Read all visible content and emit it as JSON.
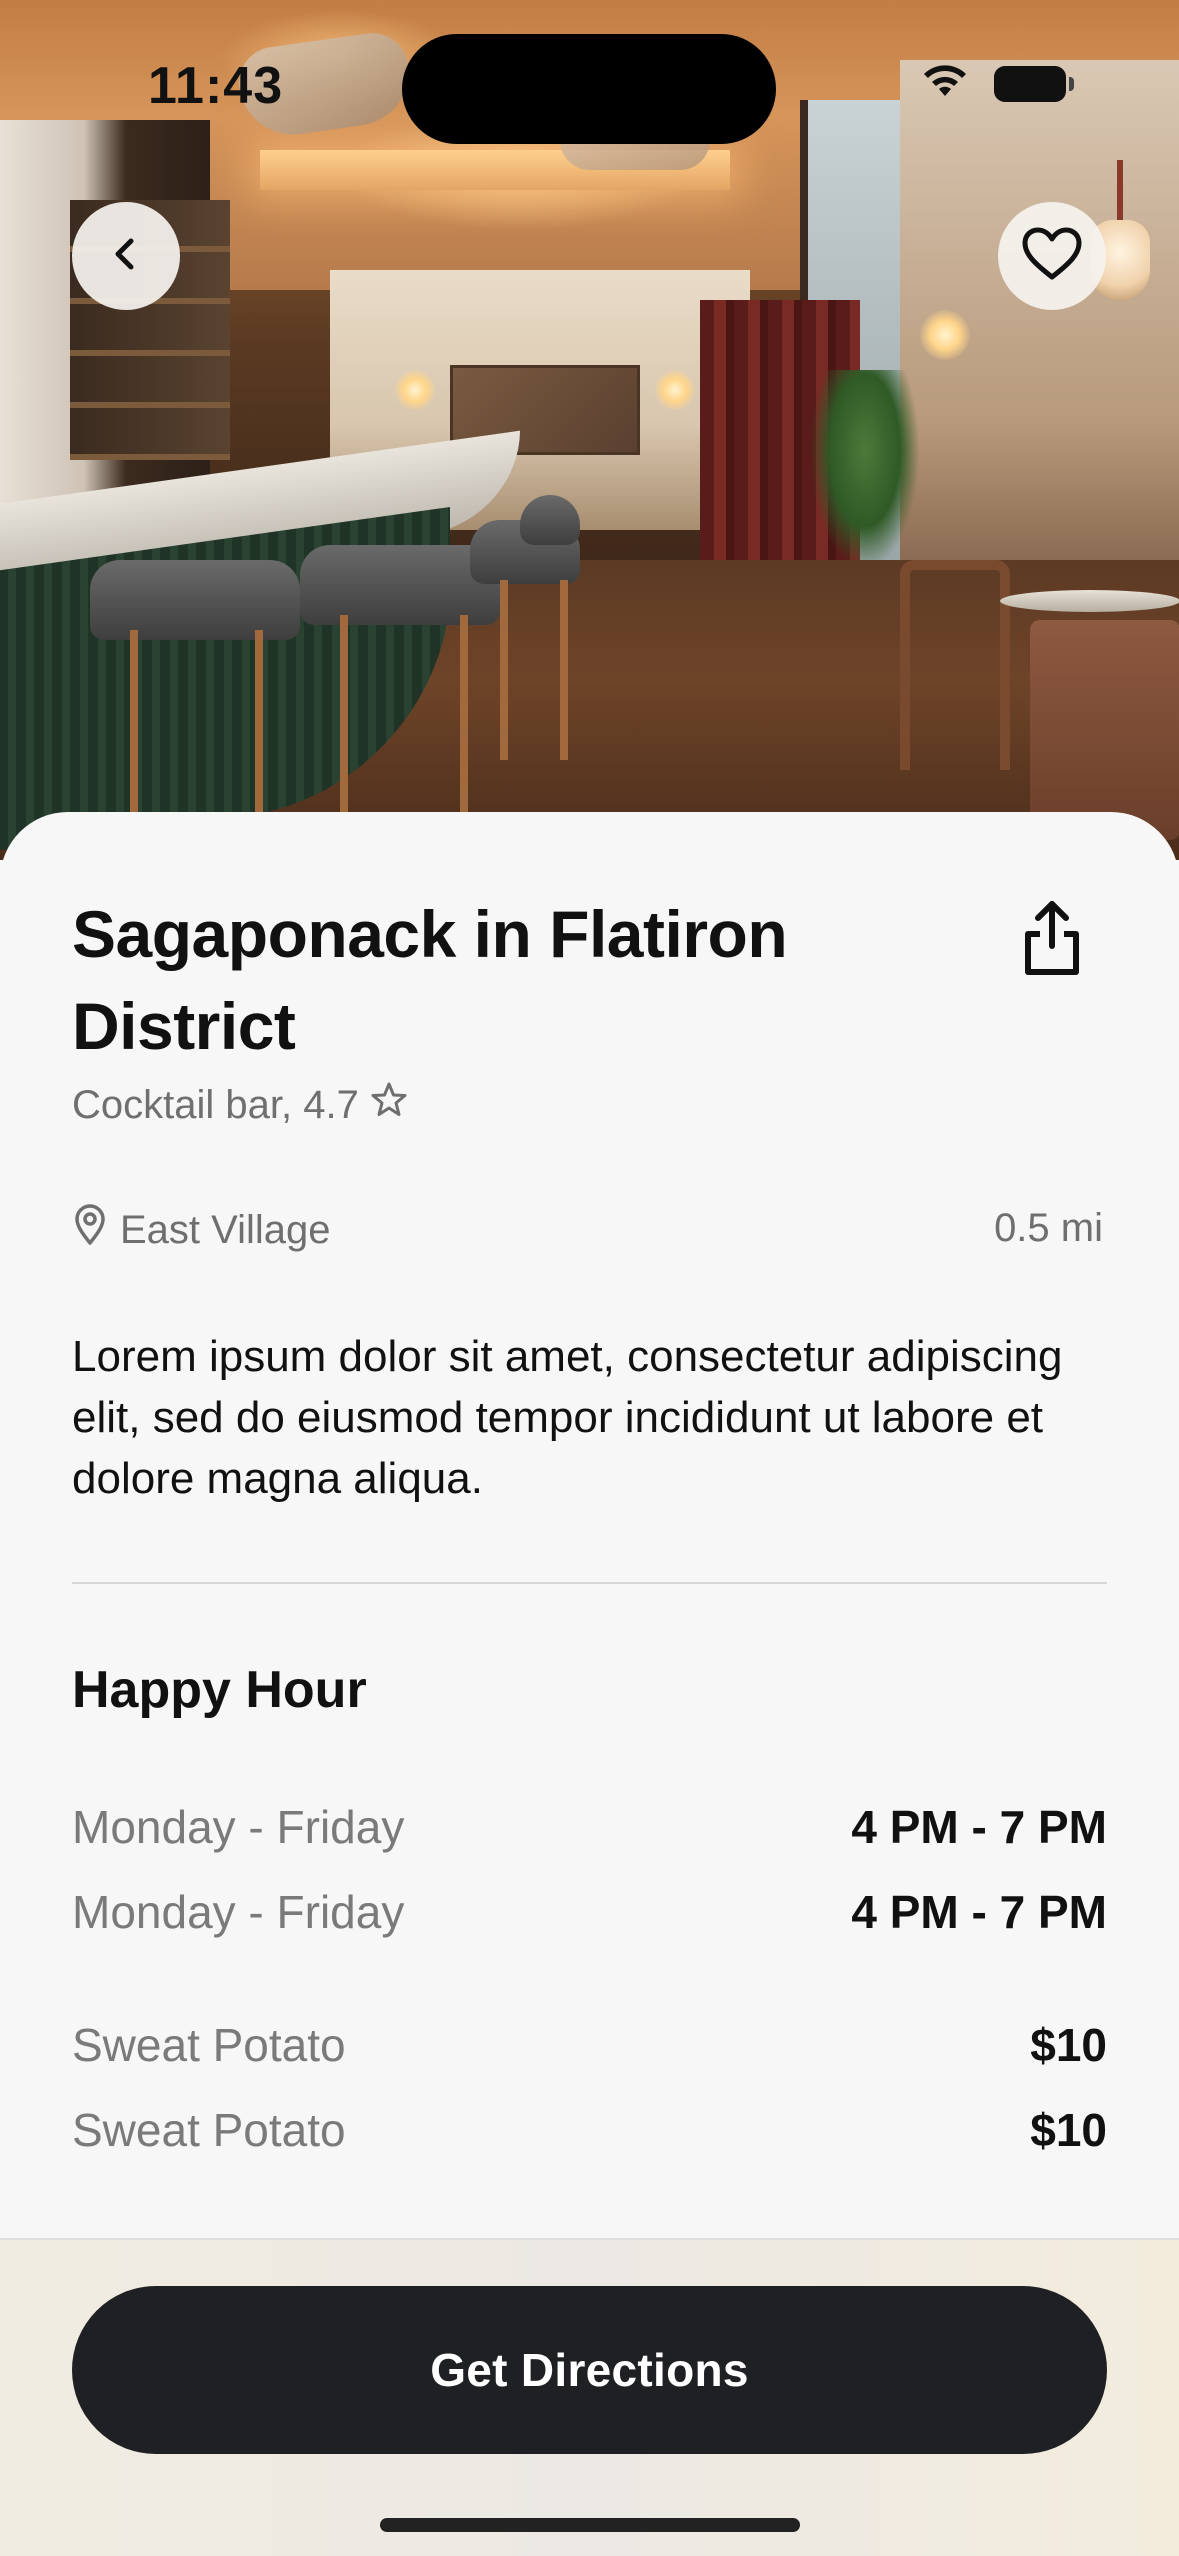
{
  "status_bar": {
    "time": "11:43"
  },
  "icons": {
    "back": "chevron-left-icon",
    "favorite": "heart-outline-icon",
    "share": "share-icon",
    "rating": "star-outline-icon",
    "location": "map-pin-icon",
    "wifi": "wifi-icon",
    "battery": "battery-icon"
  },
  "venue": {
    "name": "Sagaponack in Flatiron District",
    "category_rating": "Cocktail bar, 4.7",
    "neighborhood": "East Village",
    "distance": "0.5 mi",
    "description": "Lorem ipsum dolor sit amet, consectetur adipiscing elit, sed do eiusmod tempor incididunt ut labore et dolore magna aliqua."
  },
  "happy_hour": {
    "title": "Happy Hour",
    "schedule": [
      {
        "days": "Monday - Friday",
        "hours": "4 PM - 7 PM"
      },
      {
        "days": "Monday - Friday",
        "hours": "4 PM - 7 PM"
      }
    ],
    "specials": [
      {
        "item": "Sweat Potato",
        "price": "$10"
      },
      {
        "item": "Sweat Potato",
        "price": "$10"
      }
    ]
  },
  "cta": {
    "label": "Get Directions"
  },
  "colors": {
    "cta_bg": "#1f2023",
    "muted_text": "#6f6f6f",
    "primary_text": "#111111"
  }
}
